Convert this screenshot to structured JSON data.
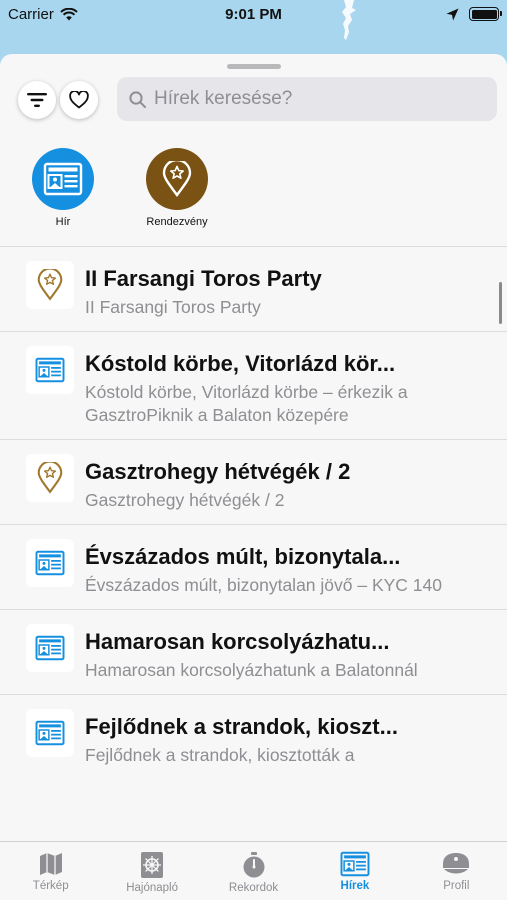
{
  "status_bar": {
    "carrier": "Carrier",
    "time": "9:01 PM"
  },
  "search": {
    "placeholder": "Hírek keresése?"
  },
  "categories": [
    {
      "label": "Hír",
      "icon": "newspaper-icon",
      "color": "#1590e0"
    },
    {
      "label": "Rendezvény",
      "icon": "event-star-pin-icon",
      "color": "#7a5213"
    }
  ],
  "items": [
    {
      "type": "event",
      "title": "II Farsangi Toros Party",
      "subtitle": "II Farsangi Toros Party"
    },
    {
      "type": "news",
      "title": "Kóstold körbe, Vitorlázd kör...",
      "subtitle": "Kóstold körbe, Vitorlázd körbe – érkezik a GasztroPiknik a Balaton közepére"
    },
    {
      "type": "event",
      "title": "Gasztrohegy hétvégék / 2",
      "subtitle": "Gasztrohegy hétvégék / 2"
    },
    {
      "type": "news",
      "title": "Évszázados múlt, bizonytala...",
      "subtitle": "Évszázados múlt, bizonytalan jövő – KYC 140"
    },
    {
      "type": "news",
      "title": "Hamarosan korcsolyázhatu...",
      "subtitle": "Hamarosan korcsolyázhatunk a Balatonnál"
    },
    {
      "type": "news",
      "title": "Fejlődnek a strandok, kioszt...",
      "subtitle": "Fejlődnek a strandok, kiosztották a"
    }
  ],
  "tabs": [
    {
      "label": "Térkép",
      "icon": "map-icon"
    },
    {
      "label": "Hajónapló",
      "icon": "ship-wheel-icon"
    },
    {
      "label": "Rekordok",
      "icon": "stopwatch-icon"
    },
    {
      "label": "Hírek",
      "icon": "newspaper-icon",
      "active": true
    },
    {
      "label": "Profil",
      "icon": "captain-hat-icon"
    }
  ],
  "colors": {
    "accent": "#1590e0",
    "event": "#a0782e",
    "map_water": "#a9d6ef"
  }
}
